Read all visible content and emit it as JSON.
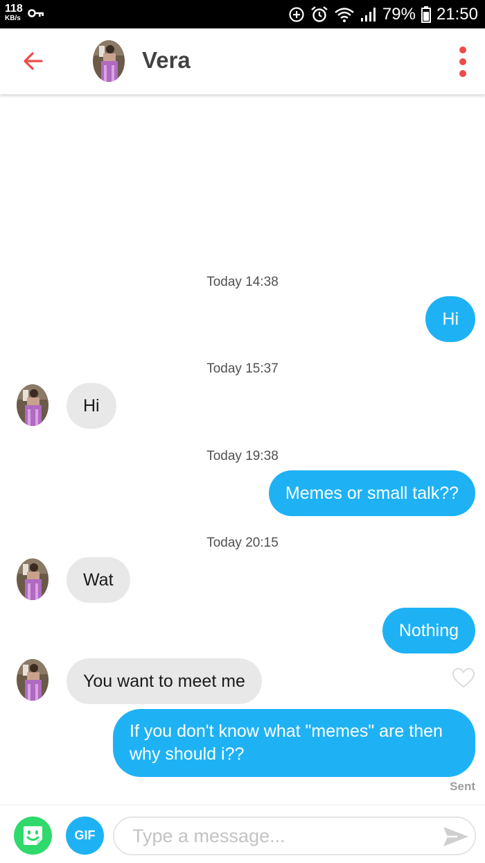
{
  "status_bar": {
    "speed_value": "118",
    "speed_unit": "KB/s",
    "battery": "79%",
    "time": "21:50"
  },
  "header": {
    "contact_name": "Vera",
    "back_icon": "arrow-left-icon",
    "menu_icon": "more-vertical-icon",
    "accent_color": "#ef4a4a"
  },
  "messages": [
    {
      "timestamp": "Today 14:38"
    },
    {
      "from": "me",
      "text": "Hi"
    },
    {
      "timestamp": "Today 15:37"
    },
    {
      "from": "them",
      "text": "Hi"
    },
    {
      "timestamp": "Today 19:38"
    },
    {
      "from": "me",
      "text": "Memes or small talk??"
    },
    {
      "timestamp": "Today 20:15"
    },
    {
      "from": "them",
      "text": "Wat"
    },
    {
      "from": "me",
      "text": "Nothing"
    },
    {
      "from": "them",
      "text": "You want to meet me"
    },
    {
      "from": "me",
      "text": "If you don't know what \"memes\" are then why should i??"
    }
  ],
  "status": {
    "sent_label": "Sent"
  },
  "composer": {
    "gif_label": "GIF",
    "placeholder": "Type a message..."
  },
  "colors": {
    "outgoing_bubble": "#1eb2f5",
    "incoming_bubble": "#e8e8e8",
    "sticker_button": "#2fd96b"
  }
}
